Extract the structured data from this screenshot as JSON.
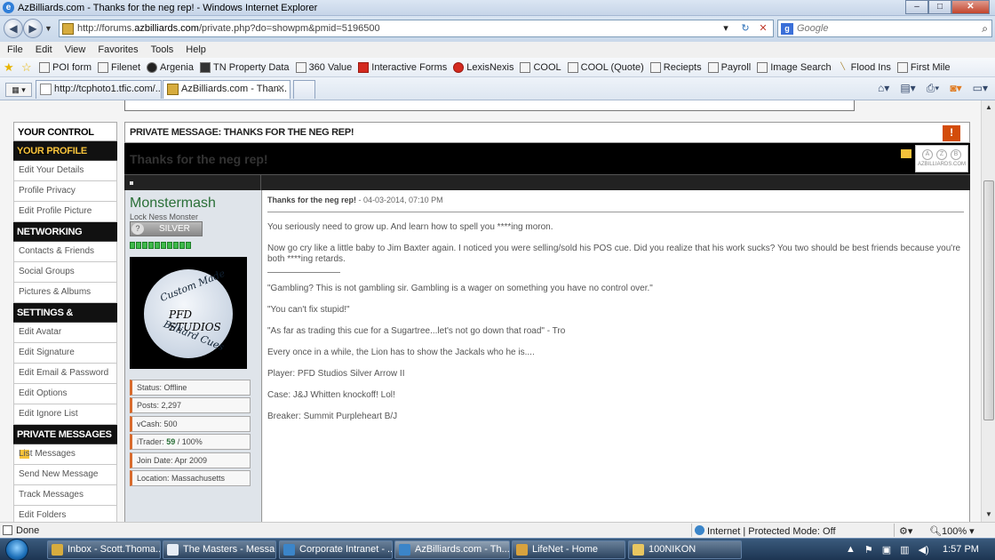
{
  "window": {
    "title": "AzBilliards.com - Thanks for the neg rep! - Windows Internet Explorer",
    "min": "–",
    "max": "□",
    "close": "✕"
  },
  "address": {
    "url_prefix": "http://forums.",
    "url_host": "azbilliards.com",
    "url_path": "/private.php?do=showpm&pmid=5196500",
    "search_placeholder": "Google",
    "search_logo": "g"
  },
  "menu": [
    "File",
    "Edit",
    "View",
    "Favorites",
    "Tools",
    "Help"
  ],
  "favorites": [
    {
      "label": "POI form",
      "icon": "web-slice-icon"
    },
    {
      "label": "Filenet",
      "icon": "page-icon"
    },
    {
      "label": "Argenia",
      "icon": "argenia-icon"
    },
    {
      "label": "TN Property Data",
      "icon": "tn-icon"
    },
    {
      "label": "360 Value",
      "icon": "house-icon"
    },
    {
      "label": "Interactive Forms",
      "icon": "forms-icon"
    },
    {
      "label": "LexisNexis",
      "icon": "lexis-icon"
    },
    {
      "label": "COOL",
      "icon": "web-slice-icon"
    },
    {
      "label": "COOL (Quote)",
      "icon": "page-icon"
    },
    {
      "label": "Reciepts",
      "icon": "web-slice-icon"
    },
    {
      "label": "Payroll",
      "icon": "web-slice-icon"
    },
    {
      "label": "Image Search",
      "icon": "web-slice-icon"
    },
    {
      "label": "Flood Ins",
      "icon": "flood-icon"
    },
    {
      "label": "First Mile",
      "icon": "page-icon"
    }
  ],
  "tabs": [
    {
      "label": "http://tcphoto1.tfic.com/..."
    },
    {
      "label": "AzBilliards.com - Than..."
    }
  ],
  "sidebar": {
    "control_panel": "YOUR CONTROL PANEL",
    "sections": [
      {
        "title": "YOUR PROFILE",
        "gold": true,
        "links": [
          "Edit Your Details",
          "Profile Privacy",
          "Edit Profile Picture"
        ]
      },
      {
        "title": "NETWORKING",
        "gold": false,
        "links": [
          "Contacts & Friends",
          "Social Groups",
          "Pictures & Albums"
        ]
      },
      {
        "title": "SETTINGS & OPTIONS",
        "gold": false,
        "links": [
          "Edit Avatar",
          "Edit Signature",
          "Edit Email & Password",
          "Edit Options",
          "Edit Ignore List"
        ]
      },
      {
        "title": "PRIVATE MESSAGES",
        "gold": false,
        "links": [
          "List Messages",
          "Send New Message",
          "Track Messages",
          "Edit Folders"
        ]
      }
    ]
  },
  "pm": {
    "header": "PRIVATE MESSAGE: THANKS FOR THE NEG REP!",
    "title": "Thanks for the neg rep!",
    "logo_letters": [
      "A",
      "Z",
      "B"
    ],
    "logo_url": "AZBILLIARDS.COM",
    "user": {
      "name": "Monstermash",
      "title": "Lock Ness Monster",
      "rank": "SILVER",
      "rep_bars": 10,
      "avatar_text": [
        "Custom Made",
        "PFD STUDIOS",
        "Billiard Cues"
      ],
      "stats": [
        {
          "label": "Status: Offline"
        },
        {
          "label": "Posts: 2,297"
        },
        {
          "label": "vCash: 500"
        },
        {
          "label": "iTrader: ",
          "value": "59",
          "suffix": " / 100%"
        },
        {
          "label": "Join Date: Apr 2009"
        },
        {
          "label": "Location: Massachusetts"
        }
      ]
    },
    "post_title": "Thanks for the neg rep!",
    "post_date": " - 04-03-2014, 07:10 PM",
    "body": [
      "You seriously need to grow up. And learn how to spell you ****ing moron.",
      "Now go cry like a little baby to Jim Baxter again. I noticed you were selling/sold his POS cue. Did you realize that his work sucks? You two should be best friends because you're both ****ing retards.",
      "\"Gambling? This is not gambling sir. Gambling is a wager on something you have no control over.\"",
      "\"You can't fix stupid!\"",
      "\"As far as trading this cue for a Sugartree...let's not go down that road\" - Tro",
      "Every once in a while, the Lion has to show the Jackals who he is....",
      "Player: PFD Studios Silver Arrow II",
      "Case: J&J Whitten knockoff! Lol!",
      "Breaker: Summit Purpleheart B/J"
    ]
  },
  "status": {
    "done": "Done",
    "zone": "Internet | Protected Mode: Off",
    "zoom": "100%"
  },
  "taskbar": {
    "items": [
      {
        "label": "Inbox - Scott.Thoma...",
        "active": false
      },
      {
        "label": "The Masters - Messa...",
        "active": false
      },
      {
        "label": "Corporate Intranet - ...",
        "active": false
      },
      {
        "label": "AzBilliards.com - Th...",
        "active": true
      },
      {
        "label": "LifeNet - Home",
        "active": false
      },
      {
        "label": "100NIKON",
        "active": false
      }
    ],
    "clock": "1:57 PM"
  }
}
